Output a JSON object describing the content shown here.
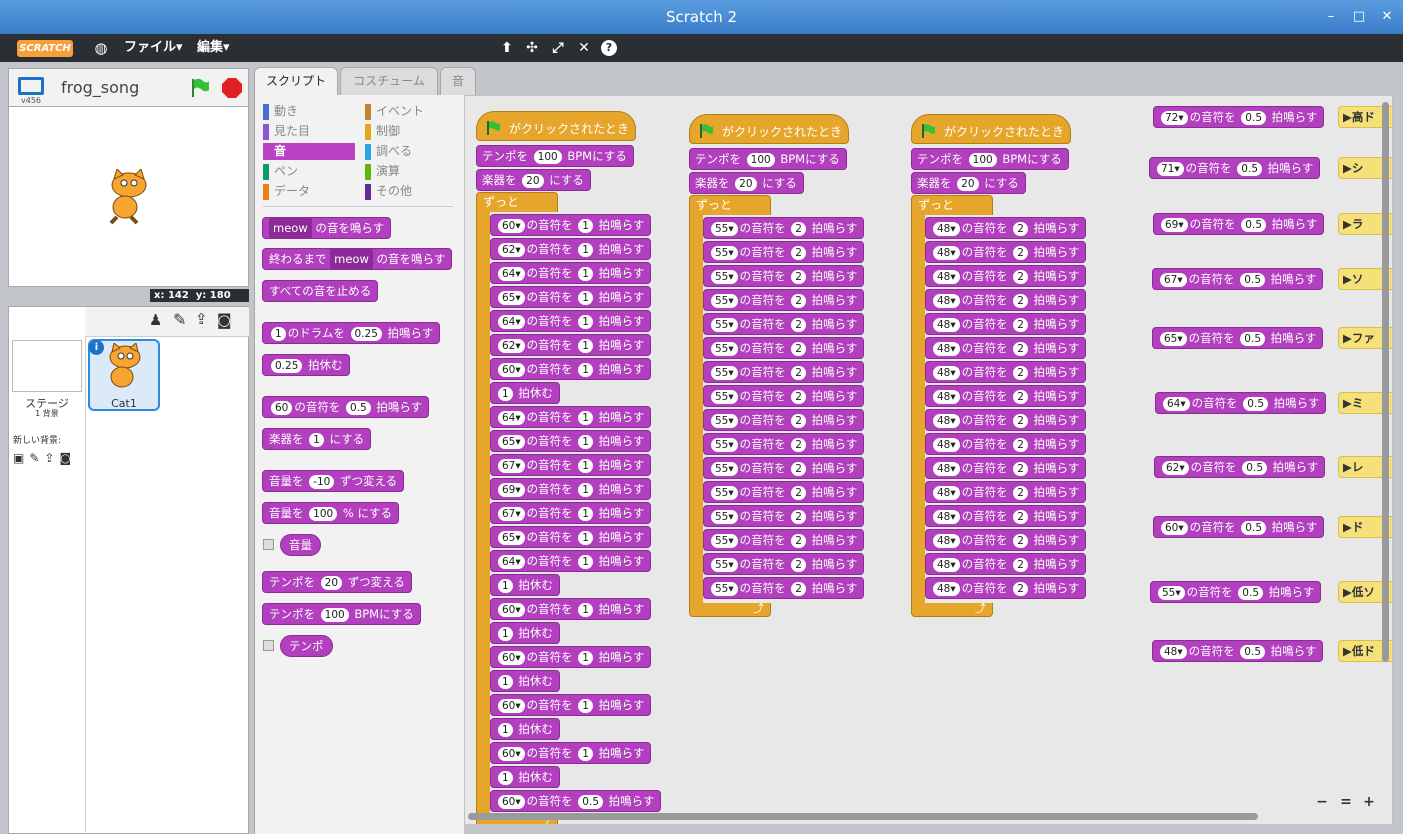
{
  "window": {
    "title": "Scratch 2",
    "controls": [
      "–",
      "□",
      "✕"
    ]
  },
  "menubar": {
    "logo": "SCRATCH",
    "file": "ファイル▾",
    "edit": "編集▾"
  },
  "stage_header": {
    "version": "v456",
    "project_name": "frog_song"
  },
  "coords": {
    "x_label": "x:",
    "x": "142",
    "y_label": "y:",
    "y": "180"
  },
  "sprites": {
    "stage_label": "ステージ",
    "stage_bg_count": "1 背景",
    "new_backdrop_label": "新しい背景:",
    "sprite_name": "Cat1"
  },
  "tabs": [
    "スクリプト",
    "コスチューム",
    "音"
  ],
  "categories": {
    "left": [
      {
        "label": "動き",
        "color": "#4a6cd4"
      },
      {
        "label": "見た目",
        "color": "#8a55d7"
      },
      {
        "label": "音",
        "color": "#bb42c3"
      },
      {
        "label": "ペン",
        "color": "#0e9a6c"
      },
      {
        "label": "データ",
        "color": "#ee7d16"
      }
    ],
    "right": [
      {
        "label": "イベント",
        "color": "#c88330"
      },
      {
        "label": "制御",
        "color": "#e1a91a"
      },
      {
        "label": "調べる",
        "color": "#2ca5e2"
      },
      {
        "label": "演算",
        "color": "#5cb712"
      },
      {
        "label": "その他",
        "color": "#632d99"
      }
    ]
  },
  "palette": {
    "play_sound_sel": "meow",
    "play_sound_txt": "の音を鳴らす",
    "until_done_pre": "終わるまで",
    "until_done_sel": "meow",
    "until_done_txt": "の音を鳴らす",
    "stop_all": "すべての音を止める",
    "drum_val": "1",
    "drum_mid": "のドラムを",
    "drum_beats": "0.25",
    "drum_txt": "拍鳴らす",
    "rest_val": "0.25",
    "rest_txt": "拍休む",
    "note_val": "60",
    "note_mid": "の音符を",
    "note_beats": "0.5",
    "note_txt": "拍鳴らす",
    "inst_pre": "楽器を",
    "inst_val": "1",
    "inst_txt": "にする",
    "vol_change_pre": "音量を",
    "vol_change_val": "-10",
    "vol_change_txt": "ずつ変える",
    "vol_set_pre": "音量を",
    "vol_set_val": "100",
    "vol_set_txt": "% にする",
    "vol_rep": "音量",
    "tempo_change_pre": "テンポを",
    "tempo_change_val": "20",
    "tempo_change_txt": "ずつ変える",
    "tempo_set_pre": "テンポを",
    "tempo_set_val": "100",
    "tempo_set_txt": "BPMにする",
    "tempo_rep": "テンポ"
  },
  "scripts": {
    "hat_text": "がクリックされたとき",
    "tempo_pre": "テンポを",
    "tempo_val": "100",
    "tempo_txt": "BPMにする",
    "inst_pre": "楽器を",
    "inst_val": "20",
    "inst_txt": "にする",
    "forever": "ずっと",
    "note_mid": "の音符を",
    "note_txt": "拍鳴らす",
    "rest_txt": "拍休む",
    "melody": [
      [
        "60",
        "1"
      ],
      [
        "62",
        "1"
      ],
      [
        "64",
        "1"
      ],
      [
        "65",
        "1"
      ],
      [
        "64",
        "1"
      ],
      [
        "62",
        "1"
      ],
      [
        "60",
        "1"
      ],
      [
        "rest",
        "1"
      ],
      [
        "64",
        "1"
      ],
      [
        "65",
        "1"
      ],
      [
        "67",
        "1"
      ],
      [
        "69",
        "1"
      ],
      [
        "67",
        "1"
      ],
      [
        "65",
        "1"
      ],
      [
        "64",
        "1"
      ],
      [
        "rest",
        "1"
      ],
      [
        "60",
        "1"
      ],
      [
        "rest",
        "1"
      ],
      [
        "60",
        "1"
      ],
      [
        "rest",
        "1"
      ],
      [
        "60",
        "1"
      ],
      [
        "rest",
        "1"
      ],
      [
        "60",
        "1"
      ],
      [
        "rest",
        "1"
      ],
      [
        "60",
        "0.5"
      ]
    ],
    "bass1": {
      "note": "55",
      "beats": "2",
      "count": 16
    },
    "bass2": {
      "note": "48",
      "beats": "2",
      "count": 16
    },
    "side_notes": [
      {
        "note": "72",
        "beats": "0.5",
        "event": "高ド"
      },
      {
        "note": "71",
        "beats": "0.5",
        "event": "シ"
      },
      {
        "note": "69",
        "beats": "0.5",
        "event": "ラ"
      },
      {
        "note": "67",
        "beats": "0.5",
        "event": "ソ"
      },
      {
        "note": "65",
        "beats": "0.5",
        "event": "ファ"
      },
      {
        "note": "64",
        "beats": "0.5",
        "event": "ミ"
      },
      {
        "note": "62",
        "beats": "0.5",
        "event": "レ"
      },
      {
        "note": "60",
        "beats": "0.5",
        "event": "ド"
      },
      {
        "note": "55",
        "beats": "0.5",
        "event": "低ソ"
      },
      {
        "note": "48",
        "beats": "0.5",
        "event": "低ド"
      }
    ]
  },
  "zoom": {
    "out": "−",
    "reset": "=",
    "in": "+"
  }
}
